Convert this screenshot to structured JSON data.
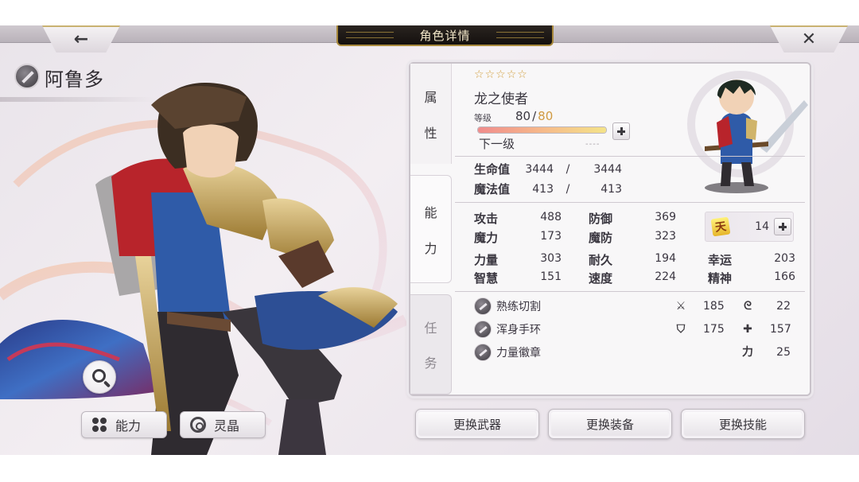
{
  "header": {
    "title": "角色详情",
    "back_icon_glyph": "←",
    "close_icon_glyph": "✕"
  },
  "character": {
    "name": "阿鲁多",
    "class_icon": "sword-icon",
    "title": "龙之使者",
    "rarity_stars": 5,
    "level_label": "等级",
    "level": "80",
    "level_max": "80",
    "level_progress_fraction": 1.0,
    "next_label": "下一级",
    "next_value": "----"
  },
  "tabs": {
    "attribute": [
      "属",
      "性"
    ],
    "ability": [
      "能",
      "力"
    ],
    "mission": [
      "任",
      "务"
    ]
  },
  "vitals": [
    {
      "label": "生命值",
      "value": "3444",
      "sep": "/",
      "max": "3444"
    },
    {
      "label": "魔法值",
      "value": "413",
      "sep": "/",
      "max": "413"
    }
  ],
  "stats": [
    {
      "label": "攻击",
      "value": "488"
    },
    {
      "label": "防御",
      "value": "369"
    },
    {
      "label": "魔力",
      "value": "173"
    },
    {
      "label": "魔防",
      "value": "323"
    },
    {
      "label": "力量",
      "value": "303"
    },
    {
      "label": "耐久",
      "value": "194"
    },
    {
      "label": "幸运",
      "value": "203"
    },
    {
      "label": "智慧",
      "value": "151"
    },
    {
      "label": "速度",
      "value": "224"
    },
    {
      "label": "精神",
      "value": "166"
    }
  ],
  "heaven": {
    "badge": "天",
    "value": "14"
  },
  "equipment": [
    {
      "name": "熟练切割",
      "icon": "sword-icon"
    },
    {
      "name": "浑身手环",
      "icon": "bracelet-icon"
    },
    {
      "name": "力量徽章",
      "icon": "badge-icon"
    }
  ],
  "equipment_stats": [
    {
      "icon": "sword-stat-icon",
      "value": "185"
    },
    {
      "icon": "magic-stat-icon",
      "value": "22"
    },
    {
      "icon": "defense-stat-icon",
      "value": "175"
    },
    {
      "icon": "magic-defense-stat-icon",
      "value": "157"
    },
    {
      "icon": "strength-stat-icon",
      "label": "力",
      "value": "25"
    }
  ],
  "left_buttons": {
    "ability": "能力",
    "crystal": "灵晶"
  },
  "actions": {
    "weapon": "更换武器",
    "equipment": "更换装备",
    "skill": "更换技能"
  },
  "colors": {
    "title_plate": "#1a1512",
    "gold_trim": "#a8893c",
    "level_max": "#d09a40",
    "star": "#d2a040"
  }
}
